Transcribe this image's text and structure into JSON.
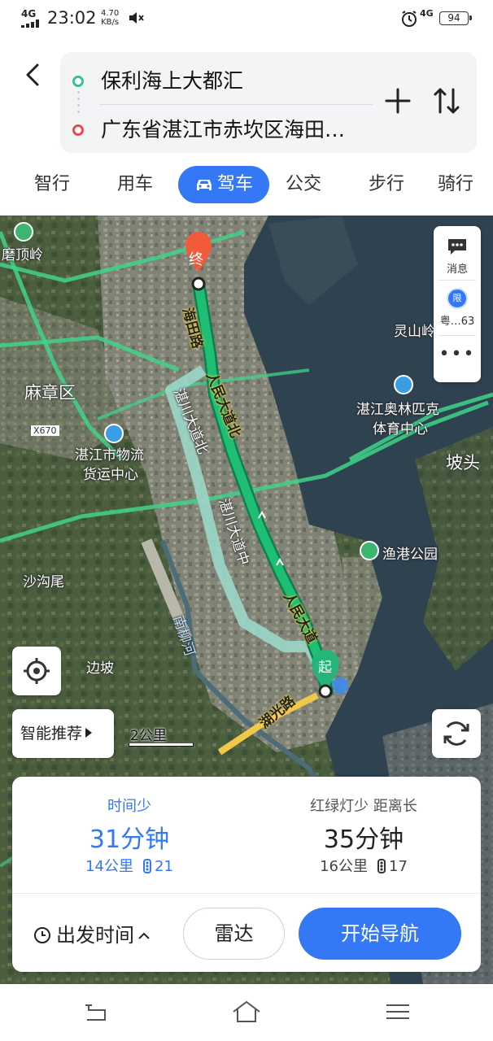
{
  "status_bar": {
    "network": "4G",
    "time": "23:02",
    "speed_value": "4.70",
    "speed_unit": "KB/s",
    "network_2": "4G",
    "battery": "94"
  },
  "route": {
    "start": "保利海上大都汇",
    "end": "广东省湛江市赤坎区海田…"
  },
  "tabs": [
    {
      "label": "智行"
    },
    {
      "label": "用车"
    },
    {
      "label": "驾车",
      "active": true
    },
    {
      "label": "公交"
    },
    {
      "label": "步行"
    },
    {
      "label": "骑行"
    }
  ],
  "map": {
    "labels": {
      "moding": "磨顶岭",
      "mazhang": "麻章区",
      "x670": "X670",
      "wuliu1": "湛江市物流",
      "wuliu2": "货运中心",
      "shagou": "沙沟尾",
      "bianpo": "边坡",
      "lingshan": "灵山岭",
      "olympic1": "湛江奥林匹克",
      "olympic2": "体育中心",
      "potou": "坡头",
      "yugang": "渔港公园",
      "haitian": "海田路",
      "renmin_n": "人民大道北",
      "renmin": "人民大道",
      "zhanchuan_bei": "湛川大道北",
      "zhanchuan_zhong": "湛川大道中",
      "nanliu": "南柳河",
      "huguang": "湖光路",
      "end_marker": "终",
      "start_marker": "起"
    },
    "side_panel": {
      "message": "消息",
      "limit": "限",
      "plate": "粤…63",
      "more": "•••"
    },
    "smart": "智能推荐",
    "scale": "2公里"
  },
  "route_options": [
    {
      "tag": "时间少",
      "time": "31分钟",
      "distance": "14公里",
      "lights": "21"
    },
    {
      "tag": "红绿灯少  距离长",
      "time": "35分钟",
      "distance": "16公里",
      "lights": "17"
    }
  ],
  "actions": {
    "depart": "出发时间",
    "radar": "雷达",
    "navigate": "开始导航"
  },
  "colors": {
    "accent": "#3478f6",
    "route": "#1faa6a",
    "start_dot": "#35c48a",
    "end_dot": "#e94a47"
  }
}
